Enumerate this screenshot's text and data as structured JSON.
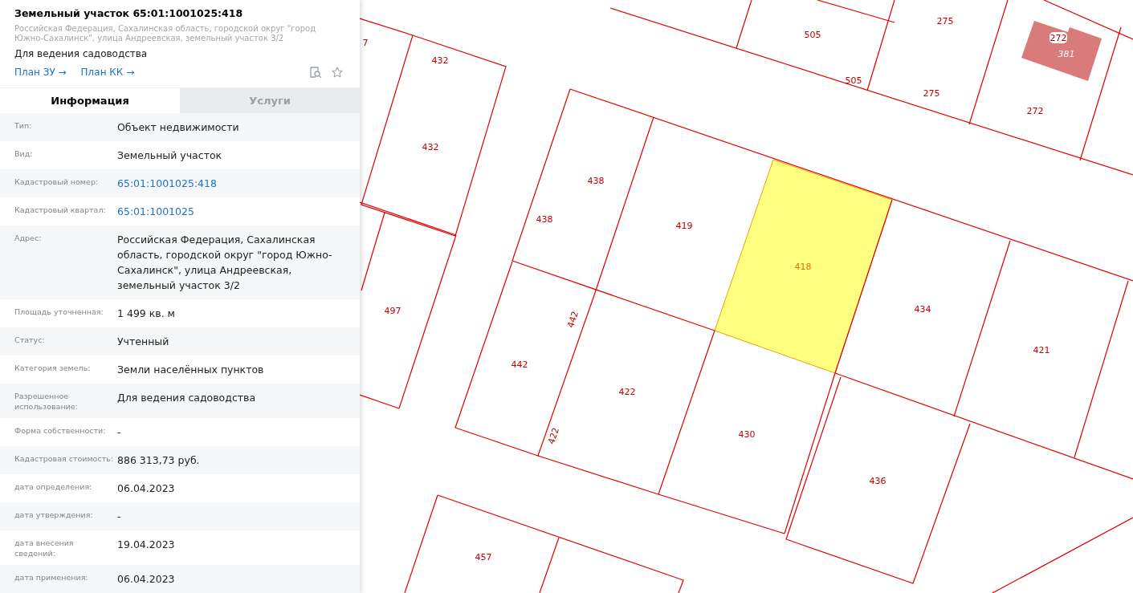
{
  "card": {
    "title": "Земельный участок 65:01:1001025:418",
    "address": "Российская Федерация, Сахалинская область, городской округ \"город Южно-Сахалинск\", улица Андреевская, земельный участок 3/2",
    "usage": "Для ведения садоводства",
    "links": [
      "План ЗУ →",
      "План КК →"
    ]
  },
  "tabs": [
    {
      "label": "Информация",
      "selected": true
    },
    {
      "label": "Услуги",
      "selected": false
    }
  ],
  "fields": [
    {
      "label": "Тип:",
      "value": "Объект недвижимости",
      "kind": "text"
    },
    {
      "label": "Вид:",
      "value": "Земельный участок",
      "kind": "text"
    },
    {
      "label": "Кадастровый номер:",
      "value": "65:01:1001025:418",
      "kind": "link"
    },
    {
      "label": "Кадастровый квартал:",
      "value": "65:01:1001025",
      "kind": "link"
    },
    {
      "label": "Адрес:",
      "value": "Российская Федерация, Сахалинская область, городской округ \"город Южно-Сахалинск\", улица Андреевская, земельный участок 3/2",
      "kind": "text"
    },
    {
      "label": "Площадь уточненная:",
      "value": "1 499 кв. м",
      "kind": "text"
    },
    {
      "label": "Статус:",
      "value": "Учтенный",
      "kind": "text"
    },
    {
      "label": "Категория земель:",
      "value": "Земли населённых пунктов",
      "kind": "text"
    },
    {
      "label": "Разрешенное использование:",
      "value": "Для ведения садоводства",
      "kind": "text"
    },
    {
      "label": "Форма собственности:",
      "value": "-",
      "kind": "text"
    },
    {
      "label": "Кадастровая стоимость:",
      "value": "886 313,73 руб.",
      "kind": "text"
    },
    {
      "label": "дата определения:",
      "value": "06.04.2023",
      "kind": "text"
    },
    {
      "label": "дата утверждения:",
      "value": "-",
      "kind": "text"
    },
    {
      "label": "дата внесения сведений:",
      "value": "19.04.2023",
      "kind": "text"
    },
    {
      "label": "дата применения:",
      "value": "06.04.2023",
      "kind": "text"
    }
  ],
  "map": {
    "labels": [
      {
        "text": "7",
        "kind": "parcel"
      },
      {
        "text": "432",
        "kind": "parcel"
      },
      {
        "text": "432",
        "kind": "parcel"
      },
      {
        "text": "505",
        "kind": "parcel"
      },
      {
        "text": "505",
        "kind": "parcel"
      },
      {
        "text": "275",
        "kind": "parcel"
      },
      {
        "text": "275",
        "kind": "parcel"
      },
      {
        "text": "272",
        "kind": "tag"
      },
      {
        "text": "381",
        "kind": "building"
      },
      {
        "text": "272",
        "kind": "parcel"
      },
      {
        "text": "438",
        "kind": "parcel"
      },
      {
        "text": "438",
        "kind": "parcel"
      },
      {
        "text": "419",
        "kind": "parcel"
      },
      {
        "text": "418",
        "kind": "selected"
      },
      {
        "text": "497",
        "kind": "parcel"
      },
      {
        "text": "434",
        "kind": "parcel"
      },
      {
        "text": "442",
        "kind": "rotated"
      },
      {
        "text": "421",
        "kind": "parcel"
      },
      {
        "text": "442",
        "kind": "parcel"
      },
      {
        "text": "422",
        "kind": "parcel"
      },
      {
        "text": "422",
        "kind": "rotated"
      },
      {
        "text": "430",
        "kind": "parcel"
      },
      {
        "text": "436",
        "kind": "parcel"
      },
      {
        "text": "457",
        "kind": "parcel"
      }
    ]
  }
}
